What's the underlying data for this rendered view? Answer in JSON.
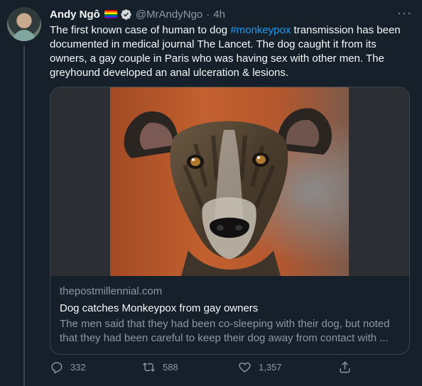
{
  "author": {
    "name": "Andy Ngô",
    "handle": "@MrAndyNgo",
    "separator": "·",
    "time": "4h",
    "avatar_icon": "avatar-portrait"
  },
  "tweet": {
    "text_before": "The first known case of human to dog ",
    "hashtag": "#monkeypox",
    "text_after": " transmission has been documented in medical journal The Lancet. The dog caught it from its owners, a gay couple in Paris who was having sex with other men. The greyhound developed an anal ulceration & lesions."
  },
  "card": {
    "domain": "thepostmillennial.com",
    "title": "Dog catches Monkeypox from gay owners",
    "description": "The men said that they had been co-sleeping with their dog, but noted that they had been careful to keep their dog away from contact with ..."
  },
  "actions": {
    "replies": "332",
    "retweets": "588",
    "likes": "1,357"
  },
  "colors": {
    "background": "#15202b",
    "text": "#f7f9f9",
    "muted": "#8b98a5",
    "accent": "#1d9bf0",
    "border": "#38444d"
  }
}
